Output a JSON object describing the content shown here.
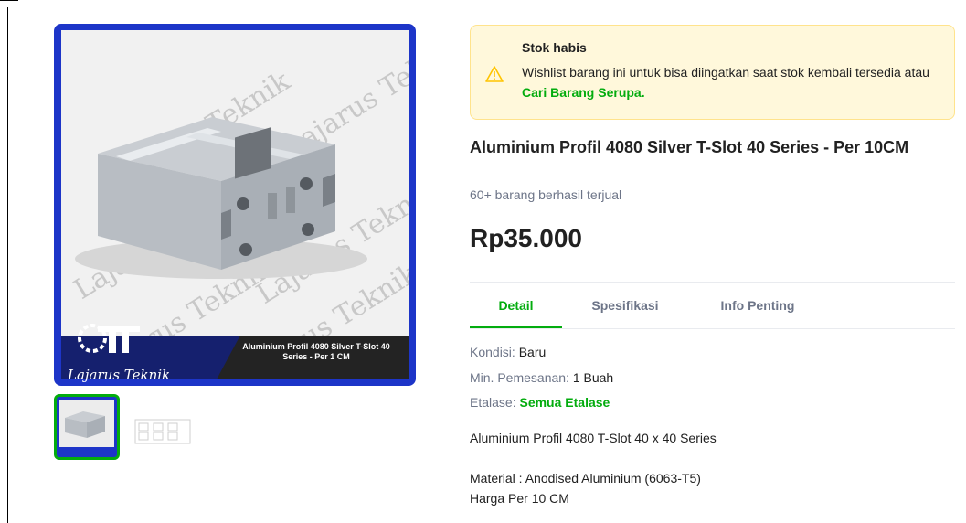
{
  "gallery": {
    "watermark": "Lajarus Teknik",
    "brand": "Lajarus Teknik",
    "banner_caption": "Aluminium Profil 4080 Silver T-Slot 40 Series - Per 1 CM"
  },
  "notice": {
    "title": "Stok habis",
    "text": "Wishlist barang ini untuk bisa diingatkan saat stok kembali tersedia atau ",
    "link": "Cari Barang Serupa."
  },
  "product": {
    "title": "Aluminium Profil 4080 Silver T-Slot 40 Series - Per 10CM",
    "sold": "60+ barang berhasil terjual",
    "price": "Rp35.000"
  },
  "tabs": [
    {
      "label": "Detail"
    },
    {
      "label": "Spesifikasi"
    },
    {
      "label": "Info Penting"
    }
  ],
  "details": {
    "condition_label": "Kondisi: ",
    "condition_value": "Baru",
    "min_order_label": "Min. Pemesanan: ",
    "min_order_value": "1 Buah",
    "showcase_label": "Etalase: ",
    "showcase_value": "Semua Etalase"
  },
  "description": {
    "line1": "Aluminium Profil 4080 T-Slot 40 x 40 Series",
    "line2": "Material : Anodised Aluminium (6063-T5)",
    "line3": "Harga Per 10 CM"
  },
  "colors": {
    "accent": "#03ac0e",
    "notice_bg": "#fff8db",
    "image_frame": "#1d35c8"
  }
}
